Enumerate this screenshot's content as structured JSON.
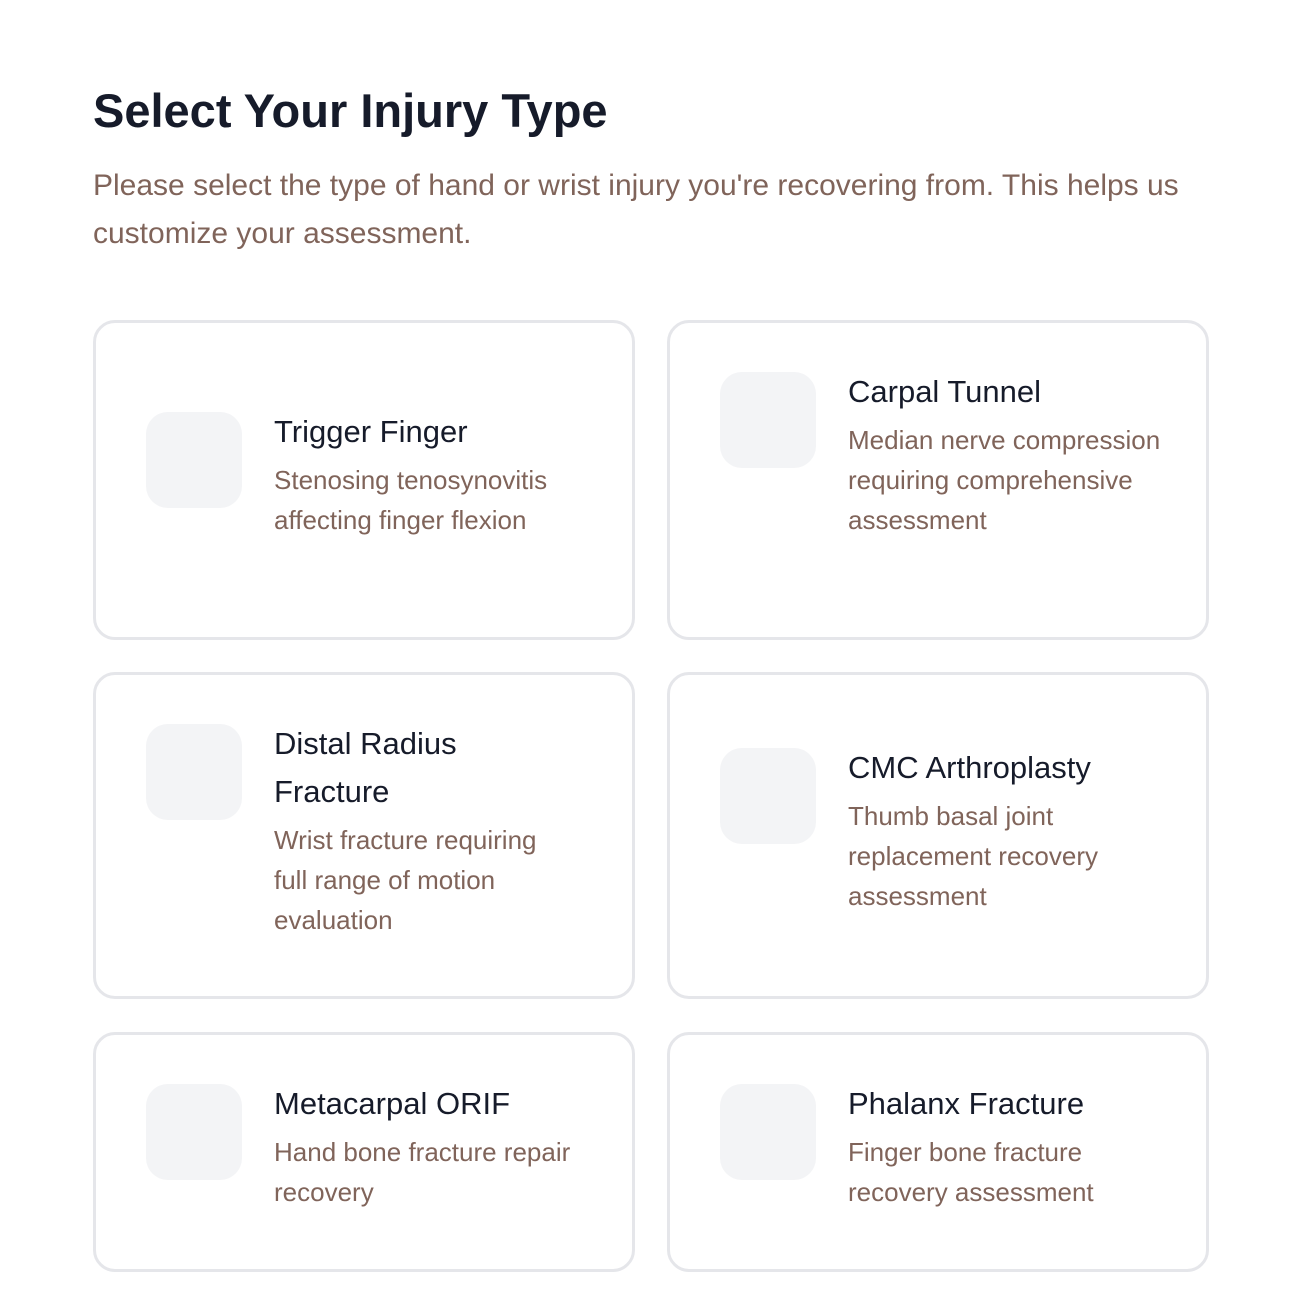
{
  "header": {
    "title": "Select Your Injury Type",
    "subtitle": "Please select the type of hand or wrist injury you're recovering from. This helps us customize your assessment."
  },
  "injuries": [
    {
      "name": "Trigger Finger",
      "description": "Stenosing tenosynovitis affecting finger flexion"
    },
    {
      "name": "Carpal Tunnel",
      "description": "Median nerve compression requiring comprehensive assessment"
    },
    {
      "name": "Distal Radius Fracture",
      "description": "Wrist fracture requiring full range of motion evaluation"
    },
    {
      "name": "CMC Arthroplasty",
      "description": "Thumb basal joint replacement recovery assessment"
    },
    {
      "name": "Metacarpal ORIF",
      "description": "Hand bone fracture repair recovery"
    },
    {
      "name": "Phalanx Fracture",
      "description": "Finger bone fracture recovery assessment"
    }
  ],
  "colors": {
    "title": "#161b2a",
    "muted_text": "#80645a",
    "card_border": "#e5e6ea",
    "icon_placeholder": "#f3f4f6"
  }
}
